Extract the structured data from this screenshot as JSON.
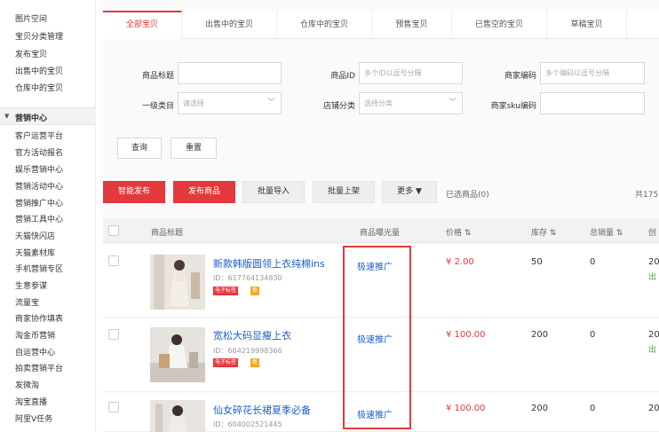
{
  "sidebar": {
    "top_items": [
      {
        "label": "图片空间"
      },
      {
        "label": "宝贝分类管理"
      },
      {
        "label": "发布宝贝"
      },
      {
        "label": "出售中的宝贝"
      },
      {
        "label": "仓库中的宝贝"
      }
    ],
    "section_label": "营销中心",
    "marketing_items": [
      {
        "label": "客户运营平台"
      },
      {
        "label": "官方活动报名"
      },
      {
        "label": "娱乐营销中心"
      },
      {
        "label": "营销活动中心"
      },
      {
        "label": "营销推广中心"
      },
      {
        "label": "营销工具中心"
      },
      {
        "label": "天猫快闪店"
      },
      {
        "label": "天猫素材库"
      },
      {
        "label": "手机营销专区"
      },
      {
        "label": "生意参谋"
      },
      {
        "label": "流量宝"
      },
      {
        "label": "商家协作填表"
      },
      {
        "label": "淘金币营销"
      },
      {
        "label": "自运营中心"
      },
      {
        "label": "拍卖营销平台"
      },
      {
        "label": "发微淘"
      },
      {
        "label": "淘宝直播"
      },
      {
        "label": "阿里V任务"
      }
    ]
  },
  "tabs": [
    {
      "label": "全部宝贝",
      "active": true
    },
    {
      "label": "出售中的宝贝"
    },
    {
      "label": "仓库中的宝贝"
    },
    {
      "label": "预售宝贝"
    },
    {
      "label": "已售空的宝贝"
    },
    {
      "label": "草稿宝贝"
    }
  ],
  "filters": {
    "title_label": "商品标题",
    "title_value": "",
    "id_label": "商品ID",
    "id_placeholder": "多个ID以逗号分隔",
    "merchant_code_label": "商家编码",
    "merchant_code_placeholder": "多个编码以逗号分隔",
    "category_label": "一级类目",
    "category_value": "请选择",
    "shop_category_label": "店铺分类",
    "shop_category_value": "选择分类",
    "sku_code_label": "商家sku编码",
    "sku_code_value": "",
    "query_button": "查询",
    "reset_button": "重置"
  },
  "actions": {
    "smart_publish": "智能发布",
    "publish": "发布商品",
    "batch_import": "批量导入",
    "batch_list": "批量上架",
    "more": "更多 ▼",
    "selected": "已选商品(0)",
    "total": "共175"
  },
  "table": {
    "headers": {
      "title": "商品标题",
      "exposure": "商品曝光量",
      "price": "价格 ⇅",
      "stock": "库存 ⇅",
      "sales": "总销量 ⇅",
      "created": "创"
    },
    "rows": [
      {
        "title": "新款韩版圆领上衣纯棉ins",
        "id": "ID：617764134830",
        "tag1": "电子标签",
        "tag2": "新",
        "promote": "极速推广",
        "price": "¥ 2.00",
        "stock": "50",
        "sales": "0",
        "date": "20",
        "status": "出"
      },
      {
        "title": "宽松大码显瘦上衣",
        "id": "ID：604219998366",
        "tag1": "电子标签",
        "tag2": "新",
        "promote": "极速推广",
        "price": "¥ 100.00",
        "stock": "200",
        "sales": "0",
        "date": "20",
        "status": "出"
      },
      {
        "title": "仙女碎花长裙夏季必备",
        "id": "ID：604002521445",
        "promote": "极速推广",
        "price": "¥ 100.00",
        "stock": "200",
        "sales": "0",
        "date": "20"
      }
    ]
  },
  "colors": {
    "accent": "#e4393c",
    "link": "#1a5ec9",
    "success": "#2fb82f"
  }
}
